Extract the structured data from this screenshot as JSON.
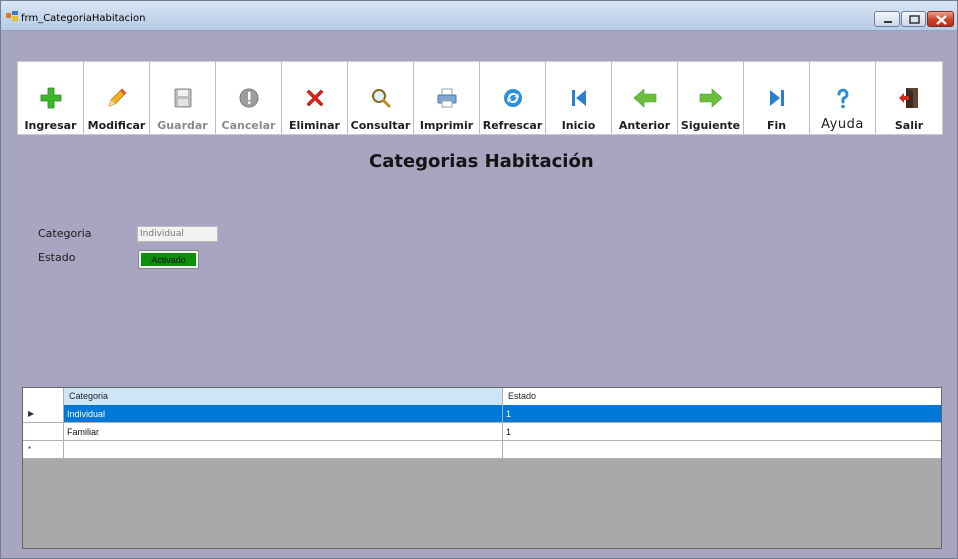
{
  "window": {
    "title": "frm_CategoriaHabitacion"
  },
  "toolbar": {
    "buttons": [
      {
        "label": "Ingresar",
        "icon": "plus-icon",
        "enabled": true
      },
      {
        "label": "Modificar",
        "icon": "pencil-icon",
        "enabled": true
      },
      {
        "label": "Guardar",
        "icon": "save-icon",
        "enabled": false
      },
      {
        "label": "Cancelar",
        "icon": "cancel-icon",
        "enabled": false
      },
      {
        "label": "Eliminar",
        "icon": "delete-icon",
        "enabled": true
      },
      {
        "label": "Consultar",
        "icon": "search-icon",
        "enabled": true
      },
      {
        "label": "Imprimir",
        "icon": "printer-icon",
        "enabled": true
      },
      {
        "label": "Refrescar",
        "icon": "refresh-icon",
        "enabled": true
      },
      {
        "label": "Inicio",
        "icon": "first-icon",
        "enabled": true
      },
      {
        "label": "Anterior",
        "icon": "arrow-left-icon",
        "enabled": true
      },
      {
        "label": "Siguiente",
        "icon": "arrow-right-icon",
        "enabled": true
      },
      {
        "label": "Fin",
        "icon": "last-icon",
        "enabled": true
      },
      {
        "label": "Ayuda",
        "icon": "help-icon",
        "enabled": true
      },
      {
        "label": "Salir",
        "icon": "exit-icon",
        "enabled": true
      }
    ]
  },
  "form": {
    "title": "Categorias Habitación",
    "categoria_label": "Categoria",
    "categoria_value": "Individual",
    "estado_label": "Estado",
    "estado_value": "Activado"
  },
  "grid": {
    "columns": [
      "Categoria",
      "Estado"
    ],
    "rows": [
      {
        "categoria": "Individual",
        "estado": "1",
        "selected": true
      },
      {
        "categoria": "Familiar",
        "estado": "1",
        "selected": false
      }
    ],
    "new_row_marker": "*",
    "current_row_marker": "▶"
  },
  "colors": {
    "form_background": "#a8a5c0",
    "selection": "#0078d7",
    "estado_active": "#0a8f0a"
  }
}
